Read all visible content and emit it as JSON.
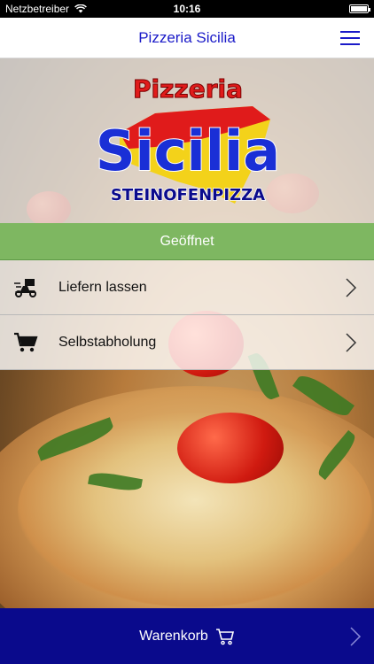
{
  "status_bar": {
    "carrier": "Netzbetreiber",
    "time": "10:16"
  },
  "header": {
    "title": "Pizzeria Sicilia",
    "menu_icon": "hamburger-menu-icon"
  },
  "logo": {
    "line1": "Pizzeria",
    "line2": "Sicilia",
    "line3": "STEINOFENPIZZA"
  },
  "status_banner": {
    "label": "Geöffnet",
    "color": "#7eb761"
  },
  "options": [
    {
      "label": "Liefern lassen",
      "icon": "delivery-scooter-icon"
    },
    {
      "label": "Selbstabholung",
      "icon": "shopping-cart-icon"
    }
  ],
  "cart": {
    "label": "Warenkorb",
    "icon": "cart-outline-icon",
    "color": "#0a0a8c"
  },
  "colors": {
    "accent": "#1a1ac8"
  }
}
